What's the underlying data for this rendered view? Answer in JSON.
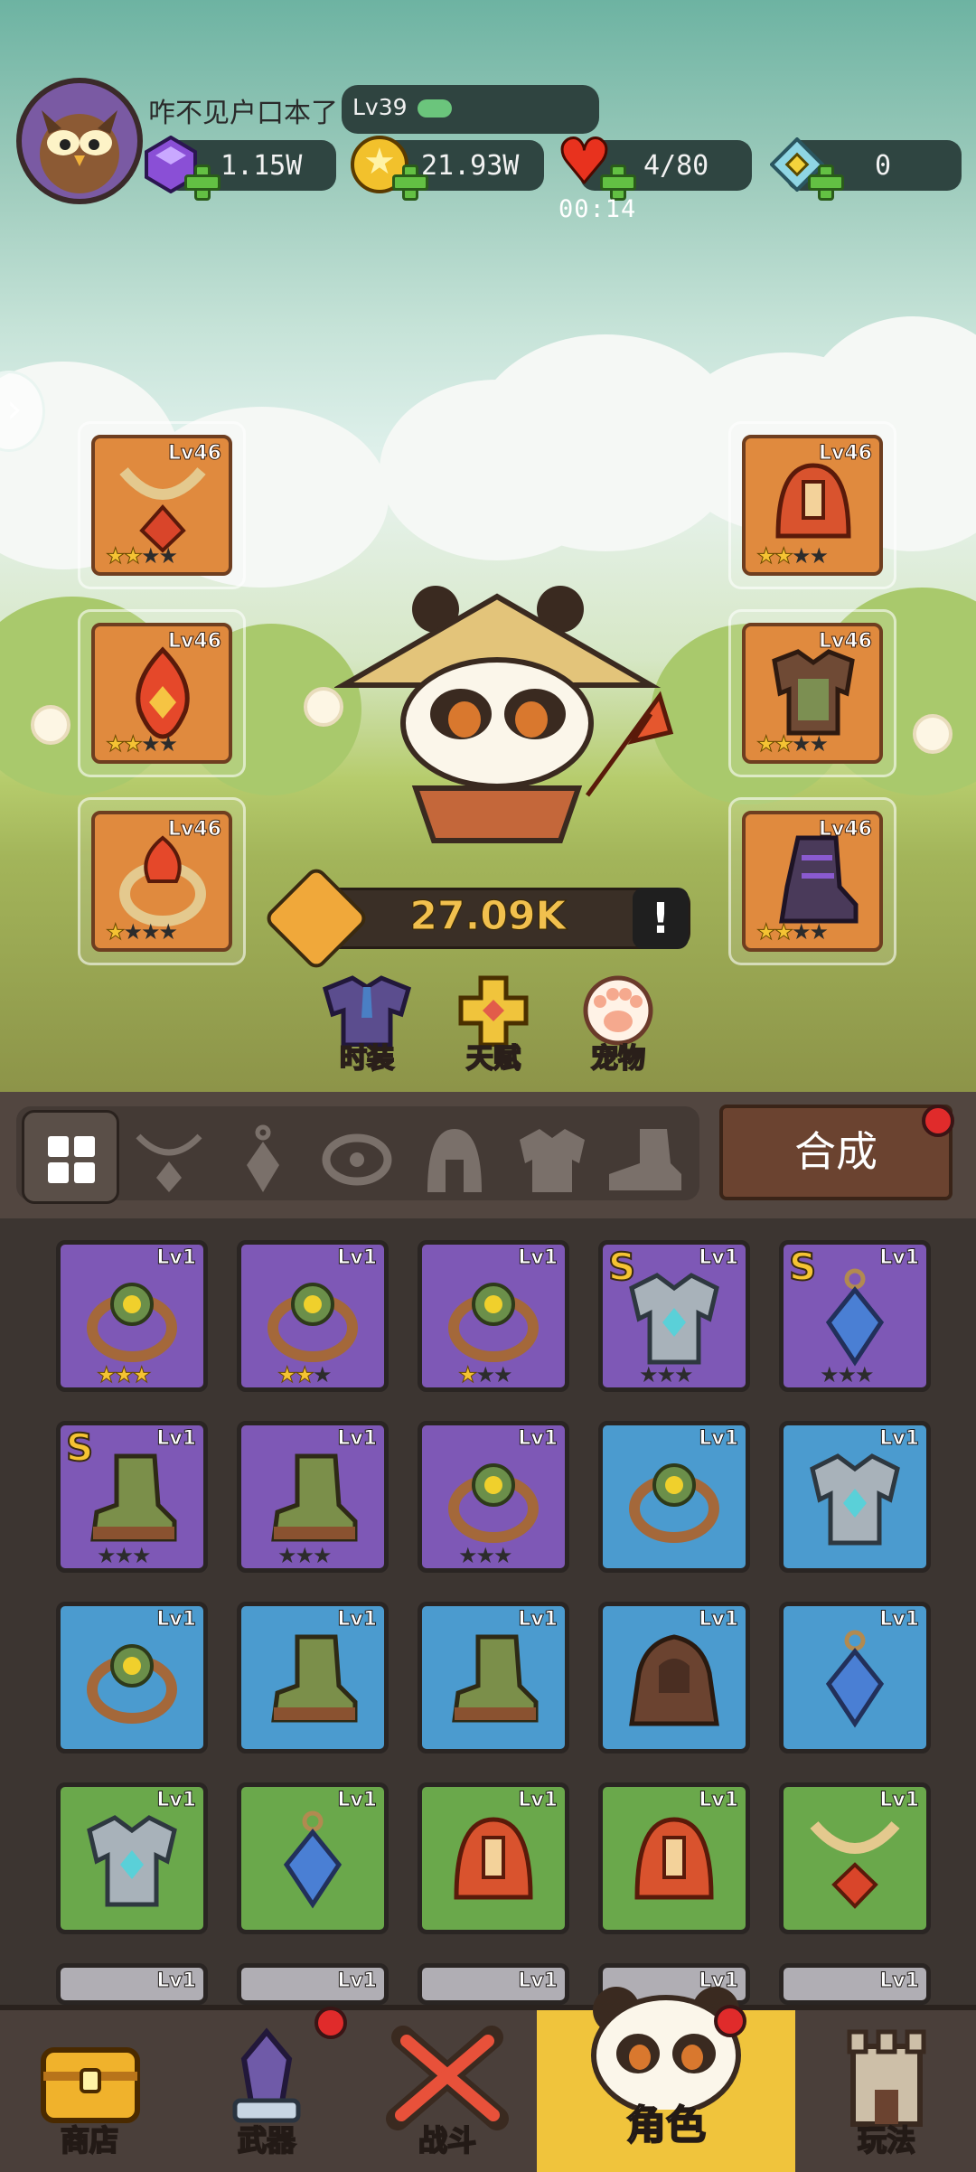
{
  "player": {
    "name": "咋不见户口本了",
    "level": "Lv39"
  },
  "resources": [
    {
      "name": "gems",
      "value": "1.15W"
    },
    {
      "name": "gold",
      "value": "21.93W"
    },
    {
      "name": "stamina",
      "value": "4/80"
    },
    {
      "name": "crystal",
      "value": "0"
    }
  ],
  "stamina_timer": "00:14",
  "equipped": {
    "necklace": {
      "level": "Lv46",
      "stars": 2
    },
    "helmet": {
      "level": "Lv46",
      "stars": 2
    },
    "amulet": {
      "level": "Lv46",
      "stars": 2
    },
    "armor": {
      "level": "Lv46",
      "stars": 2
    },
    "ring": {
      "level": "Lv46",
      "stars": 1
    },
    "boots": {
      "level": "Lv46",
      "stars": 2
    }
  },
  "power": {
    "value": "27.09K",
    "info": "!"
  },
  "actions": {
    "costume": "时装",
    "talent": "天赋",
    "pet": "宠物"
  },
  "merge_label": "合成",
  "inventory": [
    {
      "rarity": "purple",
      "grade": "",
      "level": "Lv1",
      "stars": 3,
      "icon": "ring-icon"
    },
    {
      "rarity": "purple",
      "grade": "",
      "level": "Lv1",
      "stars": 2,
      "icon": "ring-icon"
    },
    {
      "rarity": "purple",
      "grade": "",
      "level": "Lv1",
      "stars": 1,
      "icon": "ring-icon"
    },
    {
      "rarity": "purple",
      "grade": "S",
      "level": "Lv1",
      "stars": 0,
      "icon": "armor-icon"
    },
    {
      "rarity": "purple",
      "grade": "S",
      "level": "Lv1",
      "stars": 0,
      "icon": "amulet-icon"
    },
    {
      "rarity": "purple",
      "grade": "S",
      "level": "Lv1",
      "stars": 0,
      "icon": "boots-icon"
    },
    {
      "rarity": "purple",
      "grade": "",
      "level": "Lv1",
      "stars": 0,
      "icon": "boots-icon"
    },
    {
      "rarity": "purple",
      "grade": "",
      "level": "Lv1",
      "stars": 0,
      "icon": "ring-icon"
    },
    {
      "rarity": "blue",
      "grade": "",
      "level": "Lv1",
      "stars": null,
      "icon": "ring-icon"
    },
    {
      "rarity": "blue",
      "grade": "",
      "level": "Lv1",
      "stars": null,
      "icon": "armor-icon"
    },
    {
      "rarity": "blue",
      "grade": "",
      "level": "Lv1",
      "stars": null,
      "icon": "ring-icon"
    },
    {
      "rarity": "blue",
      "grade": "",
      "level": "Lv1",
      "stars": null,
      "icon": "boots-icon"
    },
    {
      "rarity": "blue",
      "grade": "",
      "level": "Lv1",
      "stars": null,
      "icon": "boots-icon"
    },
    {
      "rarity": "blue",
      "grade": "",
      "level": "Lv1",
      "stars": null,
      "icon": "cloak-icon"
    },
    {
      "rarity": "blue",
      "grade": "",
      "level": "Lv1",
      "stars": null,
      "icon": "amulet-icon"
    },
    {
      "rarity": "green",
      "grade": "",
      "level": "Lv1",
      "stars": null,
      "icon": "armor-icon"
    },
    {
      "rarity": "green",
      "grade": "",
      "level": "Lv1",
      "stars": null,
      "icon": "amulet-icon"
    },
    {
      "rarity": "green",
      "grade": "",
      "level": "Lv1",
      "stars": null,
      "icon": "helmet-icon"
    },
    {
      "rarity": "green",
      "grade": "",
      "level": "Lv1",
      "stars": null,
      "icon": "helmet-icon"
    },
    {
      "rarity": "green",
      "grade": "",
      "level": "Lv1",
      "stars": null,
      "icon": "necklace-icon"
    },
    {
      "rarity": "grey",
      "grade": "",
      "level": "Lv1",
      "stars": null,
      "icon": "armor-icon"
    },
    {
      "rarity": "grey",
      "grade": "",
      "level": "Lv1",
      "stars": null,
      "icon": "armor-icon"
    },
    {
      "rarity": "grey",
      "grade": "",
      "level": "Lv1",
      "stars": null,
      "icon": "armor-icon"
    },
    {
      "rarity": "grey",
      "grade": "",
      "level": "Lv1",
      "stars": null,
      "icon": "armor-icon"
    },
    {
      "rarity": "grey",
      "grade": "",
      "level": "Lv1",
      "stars": null,
      "icon": "armor-icon"
    }
  ],
  "nav": [
    {
      "label": "商店",
      "icon": "chest-icon",
      "badge": false
    },
    {
      "label": "武器",
      "icon": "weapon-icon",
      "badge": true
    },
    {
      "label": "战斗",
      "icon": "crossed-swords-icon",
      "badge": false
    },
    {
      "label": "角色",
      "icon": "panda-icon",
      "badge": true,
      "active": true
    },
    {
      "label": "玩法",
      "icon": "castle-icon",
      "badge": false
    }
  ]
}
